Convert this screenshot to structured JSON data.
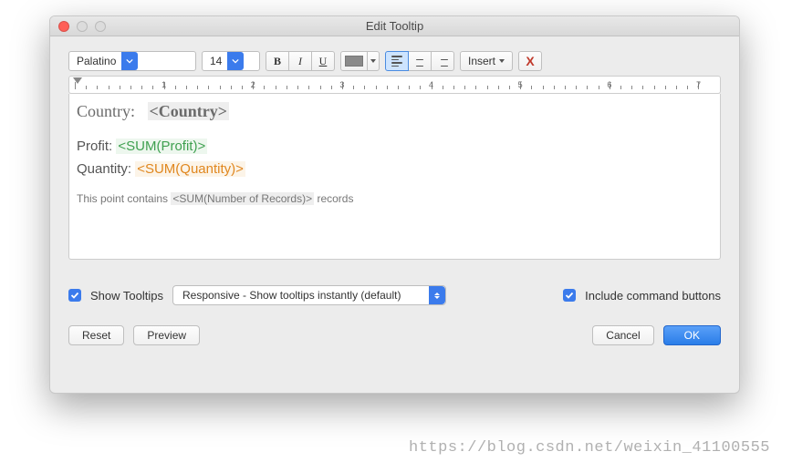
{
  "window": {
    "title": "Edit Tooltip"
  },
  "toolbar": {
    "font": "Palatino",
    "size": "14",
    "bold": "B",
    "italic": "I",
    "underline": "U",
    "insert": "Insert",
    "clear": "X"
  },
  "ruler": {
    "nums": [
      "1",
      "2",
      "3",
      "4",
      "5",
      "6",
      "7"
    ]
  },
  "editor": {
    "line1_label": "Country:",
    "line1_field": "<Country>",
    "line2_label": "Profit:",
    "line2_field": "<SUM(Profit)>",
    "line3_label": "Quantity:",
    "line3_field": "<SUM(Quantity)>",
    "line4_a": "This point contains ",
    "line4_field": "<SUM(Number of Records)>",
    "line4_b": " records"
  },
  "options": {
    "show_tooltips": "Show Tooltips",
    "mode": "Responsive - Show tooltips instantly (default)",
    "include_cmd": "Include command buttons"
  },
  "buttons": {
    "reset": "Reset",
    "preview": "Preview",
    "cancel": "Cancel",
    "ok": "OK"
  },
  "watermark": "https://blog.csdn.net/weixin_41100555"
}
